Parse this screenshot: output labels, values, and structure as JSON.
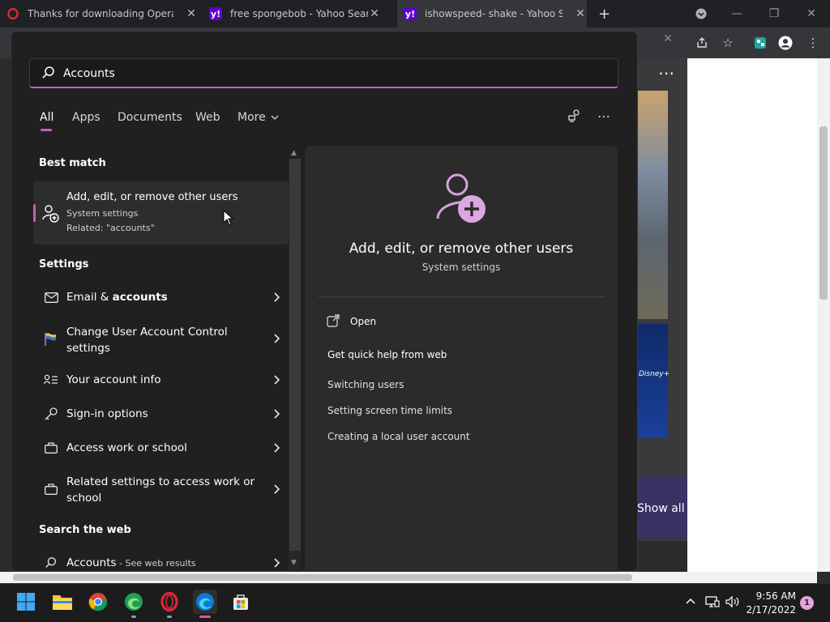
{
  "browser": {
    "tabs": [
      {
        "title": "Thanks for downloading Opera",
        "favicon": "opera-icon"
      },
      {
        "title": "free spongebob - Yahoo Search R",
        "favicon": "yahoo-icon"
      },
      {
        "title": "ishowspeed- shake - Yahoo Search",
        "favicon": "yahoo-icon"
      }
    ],
    "new_tab_symbol": "+",
    "page": {
      "show_all": "Show all",
      "thumb_brand": "Disney+"
    }
  },
  "search": {
    "query": "Accounts",
    "filter_tabs": [
      "All",
      "Apps",
      "Documents",
      "Web",
      "More"
    ],
    "active_filter": "All",
    "more_arrow": "⌄"
  },
  "results": {
    "best_match_heading": "Best match",
    "best_match": {
      "title": "Add, edit, or remove other users",
      "subtitle": "System settings",
      "related": "Related: \"accounts\""
    },
    "settings_heading": "Settings",
    "settings": [
      {
        "pre": "Email & ",
        "bold": "accounts",
        "icon": "mail-icon"
      },
      {
        "pre": "Change User Account Control",
        "line2": "settings",
        "icon": "uac-flag-icon"
      },
      {
        "pre": "Your account info",
        "icon": "account-info-icon"
      },
      {
        "pre": "Sign-in options",
        "icon": "key-icon"
      },
      {
        "pre": "Access work or school",
        "icon": "briefcase-icon"
      },
      {
        "pre": "Related settings to access work or",
        "line2": "school",
        "icon": "briefcase-icon"
      }
    ],
    "web_heading": "Search the web",
    "web": {
      "query": "Accounts",
      "hint": " - See web results"
    }
  },
  "preview": {
    "title": "Add, edit, or remove other users",
    "subtitle": "System settings",
    "open_label": "Open",
    "help_heading": "Get quick help from web",
    "links": [
      "Switching users",
      "Setting screen time limits",
      "Creating a local user account"
    ]
  },
  "taskbar": {
    "apps": [
      "start-icon",
      "file-explorer-icon",
      "chrome-icon",
      "edge-beta-icon",
      "opera-icon",
      "edge-icon",
      "store-icon"
    ],
    "time": "9:56 AM",
    "date": "2/17/2022",
    "notifications": "1"
  },
  "colors": {
    "accent": "#c65fbd",
    "panel_bg": "#202020",
    "preview_bg": "#2b2b2b"
  }
}
